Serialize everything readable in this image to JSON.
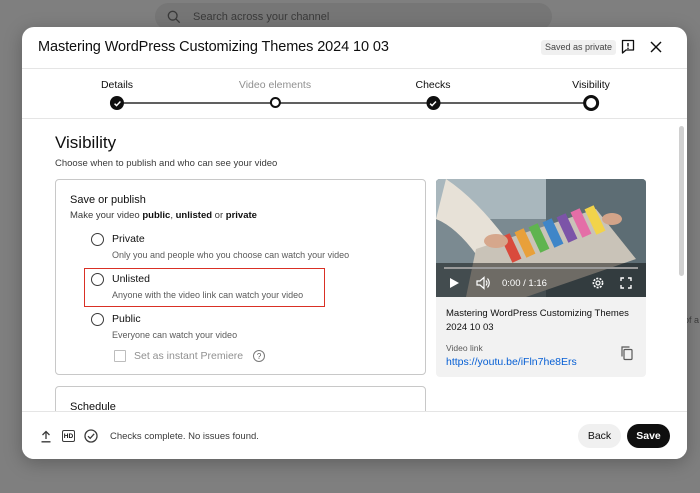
{
  "background": {
    "search_placeholder": "Search across your channel",
    "edge_text": "of a"
  },
  "dialog": {
    "title": "Mastering WordPress Customizing Themes 2024 10 03",
    "saved_status": "Saved as private",
    "icons": [
      "feedback-icon",
      "close-icon"
    ]
  },
  "stepper": {
    "steps": [
      {
        "label": "Details",
        "state": "done"
      },
      {
        "label": "Video elements",
        "state": "done"
      },
      {
        "label": "Checks",
        "state": "done"
      },
      {
        "label": "Visibility",
        "state": "current"
      }
    ]
  },
  "visibility": {
    "title": "Visibility",
    "subtitle": "Choose when to publish and who can see your video",
    "save_or_publish": {
      "title": "Save or publish",
      "subtitle_prefix": "Make your video ",
      "subtitle_public": "public",
      "subtitle_sep1": ", ",
      "subtitle_unlisted": "unlisted",
      "subtitle_or": " or ",
      "subtitle_private": "private",
      "options": [
        {
          "label": "Private",
          "description": "Only you and people who you choose can watch your video",
          "selected": false
        },
        {
          "label": "Unlisted",
          "description": "Anyone with the video link can watch your video",
          "selected": false,
          "highlighted": true
        },
        {
          "label": "Public",
          "description": "Everyone can watch your video",
          "selected": false
        }
      ],
      "premiere_label": "Set as instant Premiere",
      "premiere_help": "?"
    },
    "schedule": {
      "title": "Schedule"
    }
  },
  "video": {
    "time": "0:00 / 1:16",
    "title": "Mastering WordPress Customizing Themes 2024 10 03",
    "link_label": "Video link",
    "link": "https://youtu.be/iFln7he8Ers"
  },
  "footer": {
    "hd_label": "HD",
    "status": "Checks complete. No issues found.",
    "back_label": "Back",
    "save_label": "Save"
  },
  "colors": {
    "accent_link": "#065fd4",
    "highlight_border": "#d93025",
    "primary_button": "#0f0f0f"
  }
}
